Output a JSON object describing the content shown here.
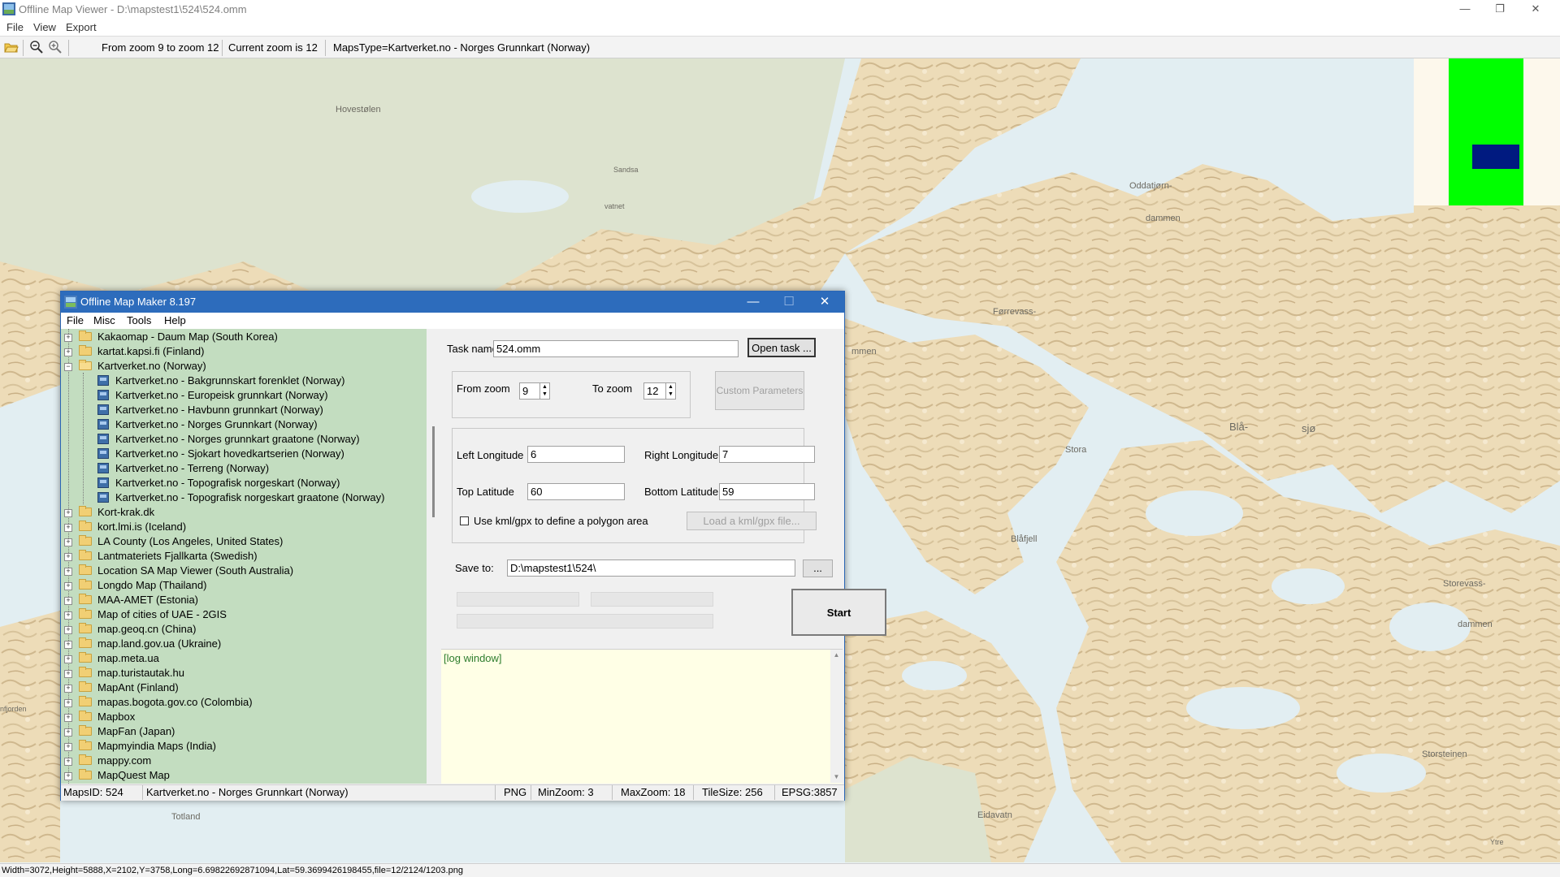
{
  "window": {
    "title": "Offline Map Viewer - D:\\mapstest1\\524\\524.omm",
    "minimize_glyph": "—",
    "restore_glyph": "❐",
    "close_glyph": "✕"
  },
  "menubar": {
    "items": [
      "File",
      "View",
      "Export"
    ]
  },
  "toolbar": {
    "zoom_range": "From zoom 9 to zoom 12",
    "current_zoom": "Current zoom is 12",
    "maps_type": "MapsType=Kartverket.no - Norges Grunnkart (Norway)"
  },
  "map": {
    "labels": [
      "Hovestølen",
      "Sandsa",
      "vatnet",
      "Oddatjørn-",
      "dammen",
      "Førrevass-",
      "mmen",
      "Blå-",
      "sjø",
      "Stora",
      "Blåfjell",
      "Storevass-",
      "dammen",
      "Storsteinen",
      "nfjorden",
      "Totland",
      "Eidavatn",
      "Ytre"
    ]
  },
  "statusbar": {
    "text": "Width=3072,Height=5888,X=2102,Y=3758,Long=6.69822692871094,Lat=59.3699426198455,file=12/2124/1203.png"
  },
  "dialog": {
    "title": "Offline Map Maker 8.197",
    "menu": [
      "File",
      "Misc",
      "Tools",
      "Help"
    ],
    "tree": {
      "collapsed_top": [
        "Kakaomap - Daum Map (South Korea)",
        "kartat.kapsi.fi (Finland)"
      ],
      "expanded": "Kartverket.no (Norway)",
      "children": [
        "Kartverket.no - Bakgrunnskart forenklet (Norway)",
        "Kartverket.no - Europeisk grunnkart (Norway)",
        "Kartverket.no - Havbunn grunnkart (Norway)",
        "Kartverket.no - Norges Grunnkart (Norway)",
        "Kartverket.no - Norges grunnkart graatone (Norway)",
        "Kartverket.no - Sjokart hovedkartserien (Norway)",
        "Kartverket.no - Terreng (Norway)",
        "Kartverket.no - Topografisk norgeskart (Norway)",
        "Kartverket.no - Topografisk norgeskart graatone (Norway)"
      ],
      "collapsed_bottom": [
        "Kort-krak.dk",
        "kort.lmi.is (Iceland)",
        "LA County (Los Angeles, United States)",
        "Lantmateriets Fjallkarta (Swedish)",
        "Location SA Map Viewer (South Australia)",
        "Longdo Map (Thailand)",
        "MAA-AMET (Estonia)",
        "Map of cities of UAE - 2GIS",
        "map.geoq.cn (China)",
        "map.land.gov.ua (Ukraine)",
        "map.meta.ua",
        "map.turistautak.hu",
        "MapAnt (Finland)",
        "mapas.bogota.gov.co (Colombia)",
        "Mapbox",
        "MapFan (Japan)",
        "Mapmyindia Maps (India)",
        "mappy.com",
        "MapQuest Map"
      ]
    },
    "form": {
      "task_name_label": "Task name",
      "task_name_value": "524.omm",
      "open_task_button": "Open task ...",
      "from_zoom_label": "From zoom",
      "from_zoom_value": "9",
      "to_zoom_label": "To zoom",
      "to_zoom_value": "12",
      "custom_params_button": "Custom Parameters",
      "left_lon_label": "Left Longitude",
      "left_lon_value": "6",
      "right_lon_label": "Right Longitude",
      "right_lon_value": "7",
      "top_lat_label": "Top Latitude",
      "top_lat_value": "60",
      "bottom_lat_label": "Bottom Latitude",
      "bottom_lat_value": "59",
      "kml_checkbox_label": "Use kml/gpx to define a polygon area",
      "load_kml_button": "Load a kml/gpx file...",
      "save_to_label": "Save to:",
      "save_to_value": "D:\\mapstest1\\524\\",
      "browse_button": "...",
      "start_button": "Start",
      "log_text": "[log window]"
    },
    "status": {
      "maps_id": "MapsID: 524",
      "map_name": "Kartverket.no - Norges Grunnkart (Norway)",
      "format": "PNG",
      "min_zoom": "MinZoom: 3",
      "max_zoom": "MaxZoom: 18",
      "tile_size": "TileSize: 256",
      "epsg": "EPSG:3857"
    }
  },
  "colors": {
    "land": "#eddcb8",
    "water": "#e2eef2",
    "tree_bg": "#c3ddc0",
    "log_bg": "#ffffe6",
    "dialog_title": "#2d6cbc",
    "minimap_area": "#00ff00",
    "minimap_view": "#001a80"
  }
}
